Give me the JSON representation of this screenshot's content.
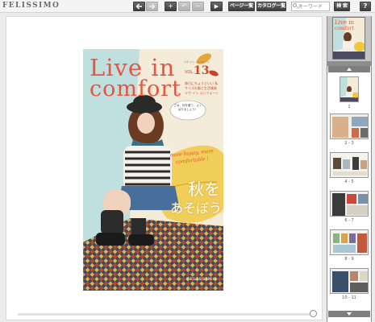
{
  "brand": {
    "logo": "FELISSIMO"
  },
  "toolbar": {
    "prev_icon": "arrow-left-icon",
    "next_icon": "arrow-right-icon",
    "zoom_in": "+",
    "undo": "↶",
    "zoom_out": "−",
    "play": "▶",
    "page_list": "ページ一覧",
    "catalog_list": "カタログ一覧",
    "search_placeholder": "キーワード",
    "search_button": "検 索",
    "help": "?"
  },
  "cover": {
    "title_line1": "Live in",
    "title_line2": "comfort",
    "issue_label": "VOL.",
    "issue_number": "13",
    "header_small": "リヴ イン コンフォート",
    "tagline": "毎日にちょうどいい 私サイズの服と生活雑貨 リヴ イン コンフォート",
    "speech_bubble": "さぁ、何を着て、よくばりましょう！",
    "headline_en": "more happy, more comfortable !",
    "headline_jp_1": "秋を",
    "headline_jp_2": "あそぼう。",
    "brand_mark": "FELISSIMO",
    "colors": {
      "title": "#e8543c",
      "accent": "#f0b21c",
      "wall_left": "#bfe0de",
      "wall_right": "#f4ecd9"
    }
  },
  "sidebar": {
    "thumbnails": [
      {
        "label": "1"
      },
      {
        "label": "2 - 3"
      },
      {
        "label": "4 - 5"
      },
      {
        "label": "6 - 7"
      },
      {
        "label": "8 - 9"
      },
      {
        "label": "10 - 11"
      }
    ]
  },
  "viewer": {
    "slider_position": 1.0
  }
}
